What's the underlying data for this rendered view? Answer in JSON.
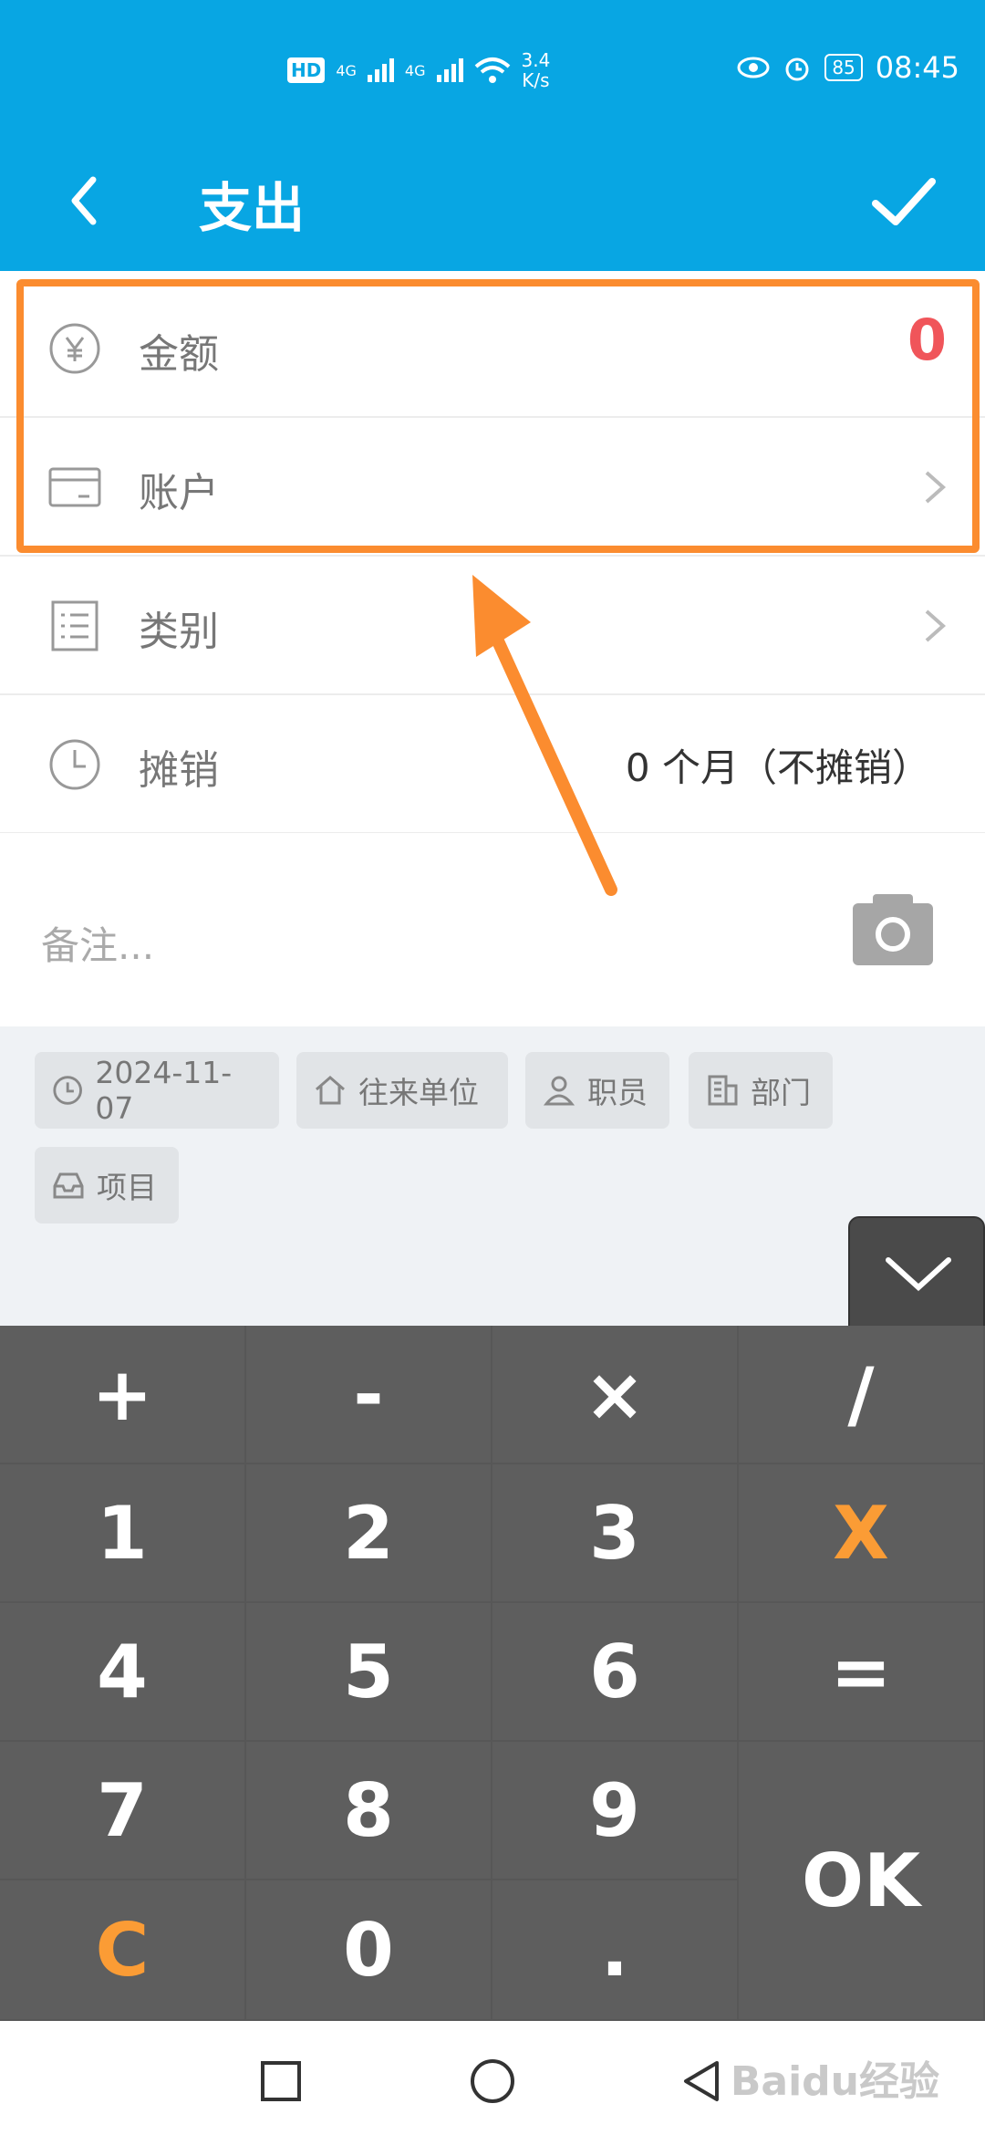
{
  "status_bar": {
    "hd": "HD",
    "net1": "4G",
    "net2": "4G",
    "speed_value": "3.4",
    "speed_unit": "K/s",
    "battery": "85",
    "time": "08:45"
  },
  "header": {
    "title": "支出"
  },
  "form": {
    "amount_label": "金额",
    "amount_value": "0",
    "account_label": "账户",
    "category_label": "类别",
    "amortize_label": "摊销",
    "amortize_value": "0  个月（不摊销）",
    "note_placeholder": "备注..."
  },
  "chips": {
    "date": "2024-11-07",
    "partner": "往来单位",
    "staff": "职员",
    "dept": "部门",
    "project": "项目"
  },
  "keypad": {
    "k_plus": "+",
    "k_minus": "-",
    "k_times": "×",
    "k_div": "/",
    "k1": "1",
    "k2": "2",
    "k3": "3",
    "k_back": "X",
    "k4": "4",
    "k5": "5",
    "k6": "6",
    "k_eq": "=",
    "k7": "7",
    "k8": "8",
    "k9": "9",
    "k_ok": "OK",
    "k_clear": "C",
    "k0": "0",
    "k_dot": "."
  },
  "watermark": "Baidu经验",
  "colors": {
    "header": "#08a6e3",
    "amount": "#f0555a",
    "highlight": "#fb8c2f",
    "keypad": "#5e5e5e",
    "key_accent": "#fb9c35"
  }
}
